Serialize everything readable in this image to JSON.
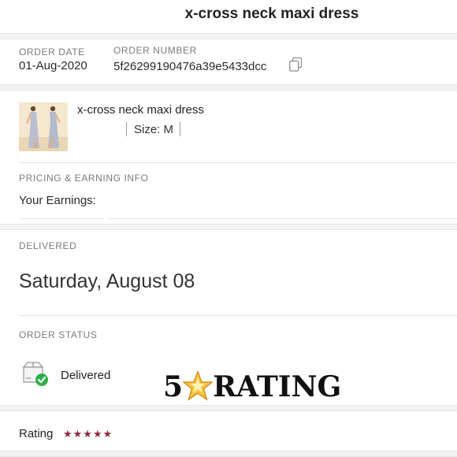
{
  "header": {
    "title": "x-cross neck maxi dress"
  },
  "order": {
    "date_label": "ORDER DATE",
    "date_value": "01-Aug-2020",
    "number_label": "ORDER NUMBER",
    "number_value": "5f26299190476a39e5433dcc"
  },
  "product": {
    "title": "x-cross neck maxi dress",
    "size_text": "Size: M",
    "thumb_bg": "#f5e8cf"
  },
  "pricing": {
    "section_label": "PRICING & EARNING INFO",
    "earnings_label": "Your Earnings:"
  },
  "delivery": {
    "section_label": "DELIVERED",
    "date": "Saturday, August 08"
  },
  "status": {
    "section_label": "ORDER STATUS",
    "value": "Delivered",
    "check_color": "#2fb04a"
  },
  "overlay": {
    "prefix": "5",
    "suffix": "RATING"
  },
  "rating": {
    "label": "Rating",
    "stars": "★★★★★",
    "star_color": "#8b2a3a"
  }
}
